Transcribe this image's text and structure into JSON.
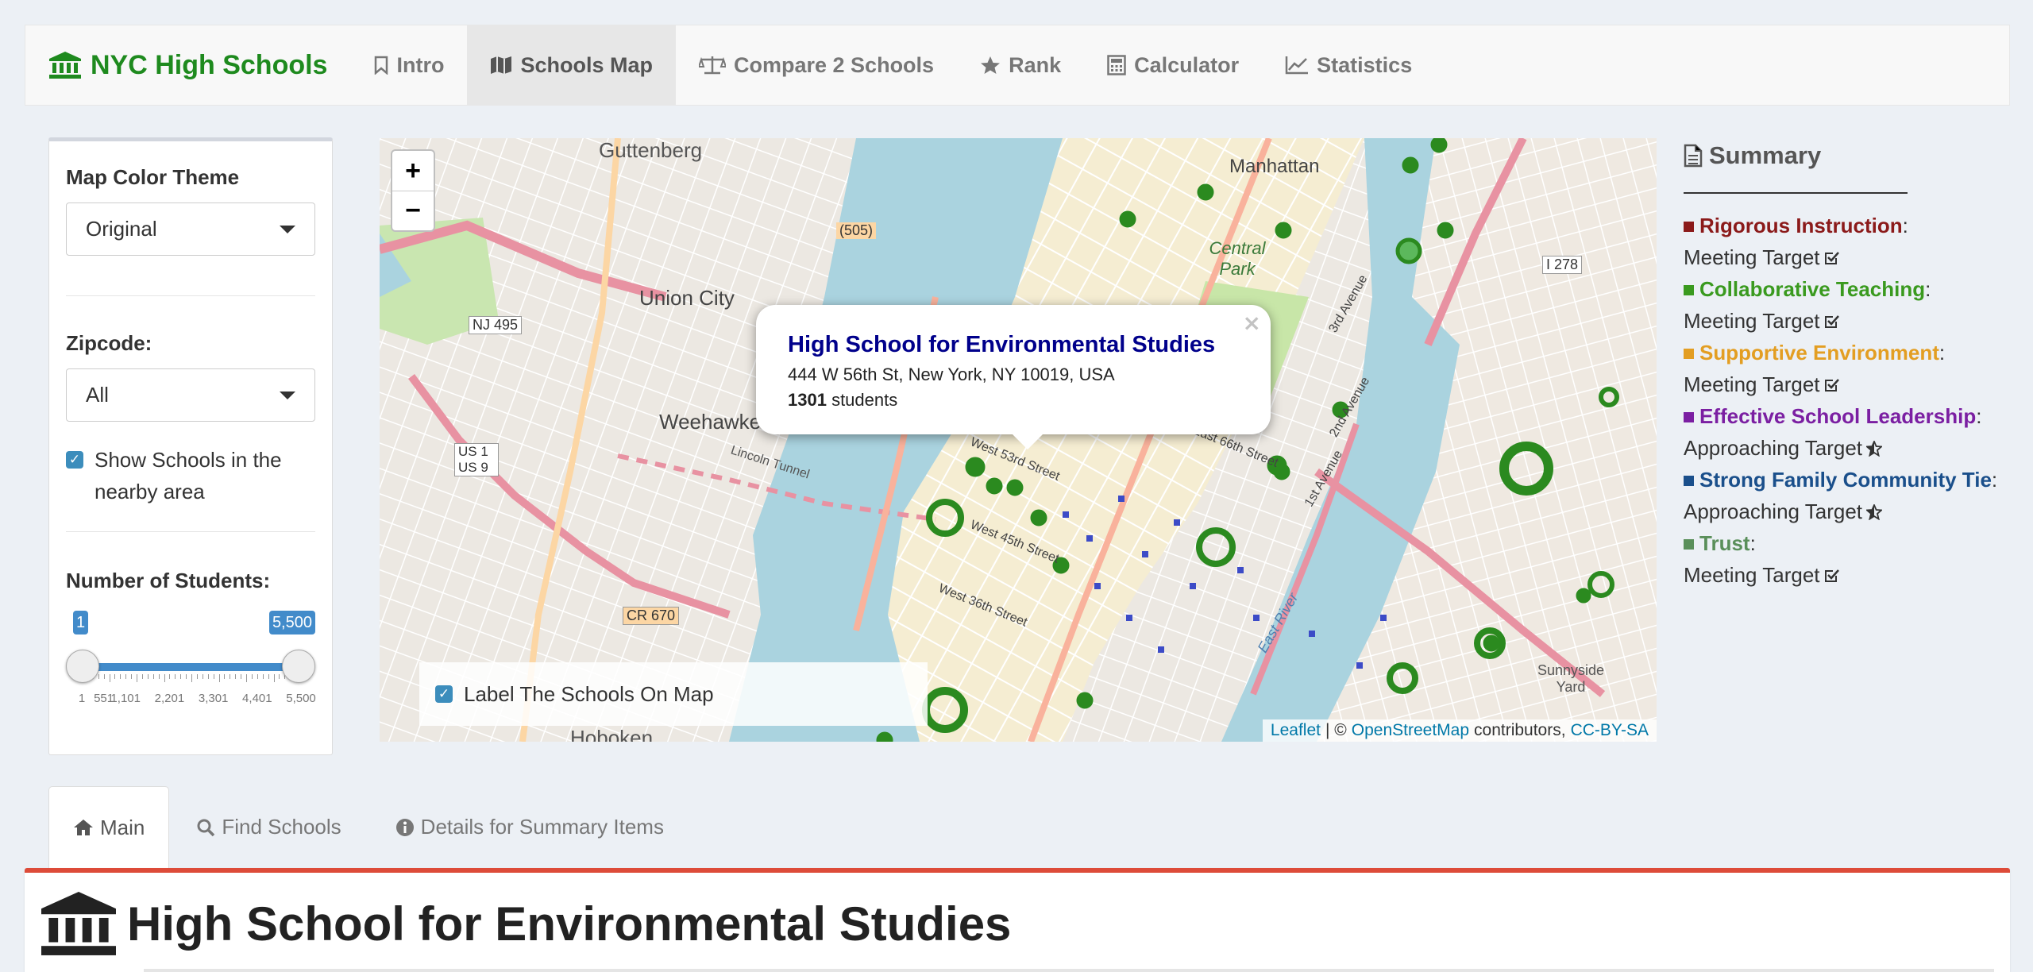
{
  "nav": {
    "brand": "NYC High Schools",
    "items": [
      {
        "label": "Intro",
        "icon": "bookmark-icon"
      },
      {
        "label": "Schools Map",
        "icon": "map-icon",
        "active": true
      },
      {
        "label": "Compare 2 Schools",
        "icon": "balance-scale-icon"
      },
      {
        "label": "Rank",
        "icon": "star-icon"
      },
      {
        "label": "Calculator",
        "icon": "calculator-icon"
      },
      {
        "label": "Statistics",
        "icon": "line-chart-icon"
      }
    ]
  },
  "sidebar": {
    "theme_label": "Map Color Theme",
    "theme_value": "Original",
    "zip_label": "Zipcode:",
    "zip_value": "All",
    "nearby_label": "Show Schools in the nearby area",
    "students_label": "Number of Students:",
    "slider": {
      "min": 1,
      "max": 5500,
      "low": 1,
      "high": 5500,
      "low_label": "1",
      "high_label": "5,500",
      "tick_labels": [
        "1",
        "551",
        "1,101",
        "2,201",
        "3,301",
        "4,401",
        "5,500"
      ]
    }
  },
  "map": {
    "zoom_in": "+",
    "zoom_out": "−",
    "popup": {
      "title": "High School for Environmental Studies",
      "address": "444 W 56th St, New York, NY 10019, USA",
      "students_count": "1301",
      "students_suffix": " students",
      "close": "×"
    },
    "label_checkbox": "Label The Schools On Map",
    "attribution": {
      "leaflet": "Leaflet",
      "sep": "| ©",
      "osm": "OpenStreetMap",
      "contributors": "contributors,",
      "license": "CC-BY-SA"
    },
    "place_labels": [
      "Guttenberg",
      "Manhattan",
      "Union City",
      "Central Park",
      "Weehawken",
      "NJ 495",
      "US 1 US 9",
      "(505)",
      "CR 670",
      "I 278",
      "Lincoln Tunnel",
      "West 53rd Street",
      "West 45th Street",
      "West 36th Street",
      "East 66th Street",
      "1st Avenue",
      "2nd Avenue",
      "3rd Avenue",
      "East River",
      "Sunnyside Yard",
      "Hoboken"
    ]
  },
  "summary": {
    "title": "Summary",
    "items": [
      {
        "name": "Rigorous Instruction",
        "color": "#8b1a1a",
        "status": "Meeting Target",
        "status_icon": "check-square-icon"
      },
      {
        "name": "Collaborative Teaching",
        "color": "#3a9a1f",
        "status": "Meeting Target",
        "status_icon": "check-square-icon"
      },
      {
        "name": "Supportive Environment",
        "color": "#e39e22",
        "status": "Meeting Target",
        "status_icon": "check-square-icon"
      },
      {
        "name": "Effective School Leadership",
        "color": "#7b1fa2",
        "status": "Approaching Target",
        "status_icon": "star-half-icon"
      },
      {
        "name": "Strong Family Community Tie",
        "color": "#1a4f8b",
        "status": "Approaching Target",
        "status_icon": "star-half-icon"
      },
      {
        "name": "Trust",
        "color": "#5a8f5a",
        "status": "Meeting Target",
        "status_icon": "check-square-icon"
      }
    ]
  },
  "tabs": [
    {
      "label": "Main",
      "icon": "home-icon",
      "active": true
    },
    {
      "label": "Find Schools",
      "icon": "search-icon"
    },
    {
      "label": "Details for Summary Items",
      "icon": "info-circle-icon"
    }
  ],
  "panel": {
    "title": "High School for Environmental Studies",
    "icon": "institution-icon"
  }
}
